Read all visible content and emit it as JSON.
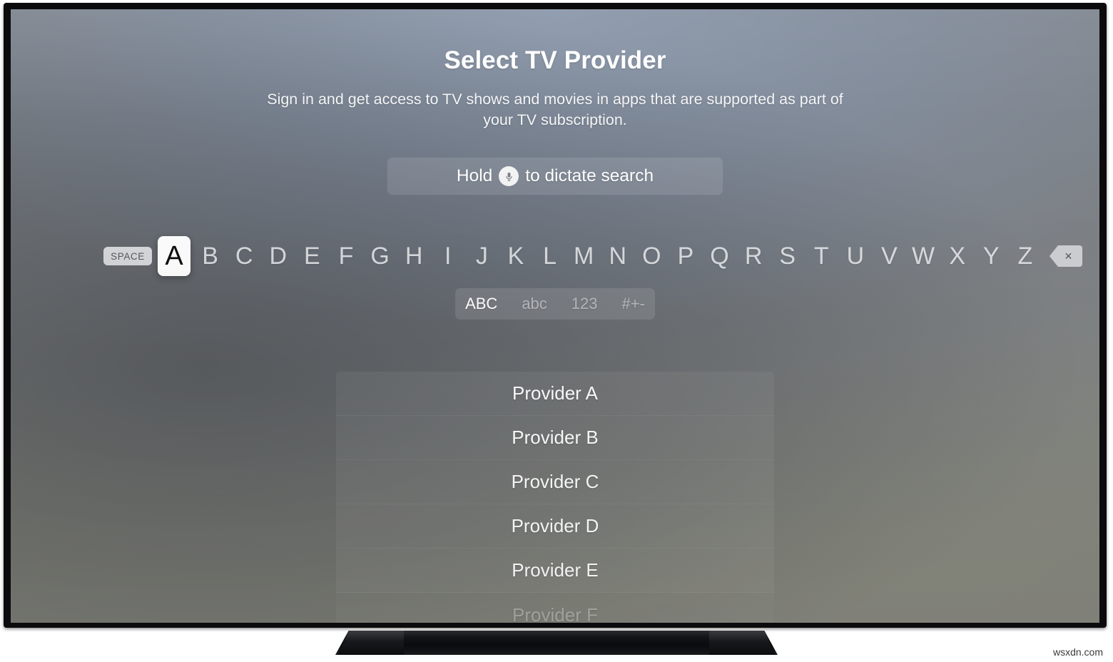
{
  "screen": {
    "title": "Select TV Provider",
    "subtitle": "Sign in and get access to TV shows and movies in apps that are supported as part of your TV subscription."
  },
  "dictate": {
    "prefix": "Hold",
    "suffix": "to dictate search",
    "icon": "microphone-icon"
  },
  "keyboard": {
    "space_label": "SPACE",
    "letters": [
      "A",
      "B",
      "C",
      "D",
      "E",
      "F",
      "G",
      "H",
      "I",
      "J",
      "K",
      "L",
      "M",
      "N",
      "O",
      "P",
      "Q",
      "R",
      "S",
      "T",
      "U",
      "V",
      "W",
      "X",
      "Y",
      "Z"
    ],
    "selected_letter": "A",
    "delete_icon": "backspace-delete-icon",
    "delete_glyph": "×"
  },
  "mode_selector": {
    "options": [
      "ABC",
      "abc",
      "123",
      "#+-"
    ],
    "selected": "ABC"
  },
  "providers": [
    {
      "label": "Provider A",
      "dimmed": false
    },
    {
      "label": "Provider B",
      "dimmed": false
    },
    {
      "label": "Provider C",
      "dimmed": false
    },
    {
      "label": "Provider D",
      "dimmed": false
    },
    {
      "label": "Provider E",
      "dimmed": false
    },
    {
      "label": "Provider F",
      "dimmed": true
    }
  ],
  "watermark": "wsxdn.com",
  "colors": {
    "screen_top": "#8c99ac",
    "screen_bottom": "#85867e",
    "bezel": "#0b0b0d",
    "selected_key_bg": "#fdfdfd",
    "selected_key_text": "#0d0d0d",
    "text_primary": "#ffffff"
  }
}
